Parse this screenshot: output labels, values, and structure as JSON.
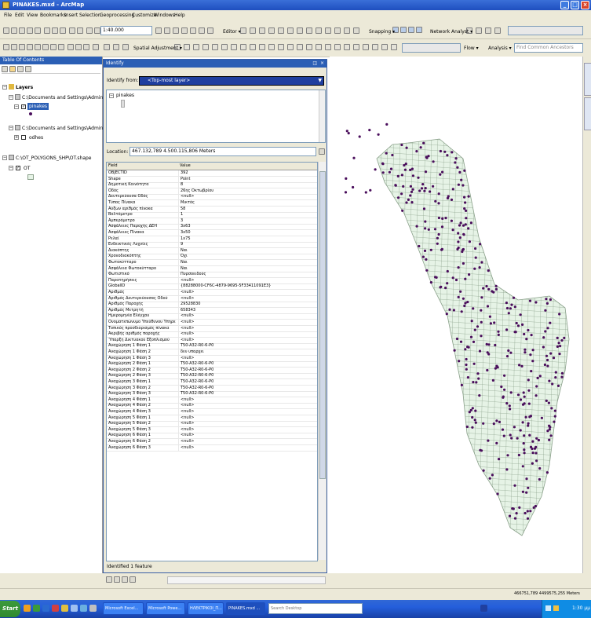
{
  "window": {
    "title": "PINAKES.mxd - ArcMap"
  },
  "menu": [
    "File",
    "Edit",
    "View",
    "Bookmarks",
    "Insert",
    "Selection",
    "Geoprocessing",
    "Customize",
    "Windows",
    "Help"
  ],
  "toolbar": {
    "scale": "1:40.000",
    "editor": "Editor ▾",
    "snapping": "Snapping ▾",
    "network_analyst": "Network Analyst ▾",
    "spatial_adjustment": "Spatial Adjustment ▾",
    "flow": "Flow ▾",
    "analysis": "Analysis ▾",
    "find_common_ancestors": "Find Common Ancestors"
  },
  "toc": {
    "title": "Table Of Contents",
    "layers_label": "Layers",
    "group1_path": "C:\\Documents and Settings\\Administrator\\Desk",
    "layer_pinakes": "pinakes",
    "group2_path": "C:\\Documents and Settings\\Administrator\\Desk",
    "layer_odhes": "odhes",
    "group3_path": "C:\\OT_POLYGONS_SHP\\OT.shape",
    "layer_ot": "OT"
  },
  "identify": {
    "title": "Identify",
    "identify_from_label": "Identify from:",
    "identify_from_value": "<Top-most layer>",
    "tree_item": "pinakes",
    "location_label": "Location:",
    "location_value": "467.132,789  4.500.115,806 Meters",
    "col_field": "Field",
    "col_value": "Value",
    "footer": "Identified 1 feature",
    "rows": [
      {
        "f": "OBJECTID",
        "v": "392"
      },
      {
        "f": "Shape",
        "v": "Point"
      },
      {
        "f": "Δημοτική Κοινότητα",
        "v": "8"
      },
      {
        "f": "Οδός",
        "v": "26ης Οκτωβρίου"
      },
      {
        "f": "Δευτερεύουσα Οδός",
        "v": "<null>"
      },
      {
        "f": "Τύπος Πίνακα",
        "v": "Μικτός"
      },
      {
        "f": "Αύξων αριθμός πίνακα",
        "v": "58"
      },
      {
        "f": "Βολτόμετρο",
        "v": "1"
      },
      {
        "f": "Αμπερόμετρο",
        "v": "3"
      },
      {
        "f": "Ασφάλειες Παροχής ΔΕΗ",
        "v": "3x63"
      },
      {
        "f": "Ασφάλειες Πίνακα",
        "v": "3x50"
      },
      {
        "f": "Ρελαί",
        "v": "1x75"
      },
      {
        "f": "Ενδεικτικές Λυχνίες",
        "v": "9"
      },
      {
        "f": "Διακόπτης",
        "v": "Ναι"
      },
      {
        "f": "Χρονοδιακόπτης",
        "v": "Όχι"
      },
      {
        "f": "Φωτοκύτταρο",
        "v": "Ναι"
      },
      {
        "f": "Ασφάλεια Φωτοκύτταρο",
        "v": "Ναι"
      },
      {
        "f": "Φωτιστικό",
        "v": "Πυρσοειδούς"
      },
      {
        "f": "Παρατηρήσεις",
        "v": "<null>"
      },
      {
        "f": "GlobalID",
        "v": "{88288000-CF6C-4879-9695-5F33411091E3}"
      },
      {
        "f": "Αριθμός",
        "v": "<null>"
      },
      {
        "f": "Αριθμός Δευτερεύουσας Οδού",
        "v": "<null>"
      },
      {
        "f": "Αριθμός Παροχής",
        "v": "29528830"
      },
      {
        "f": "Αριθμός Μετρητή",
        "v": "658343"
      },
      {
        "f": "Ημερομηνία Ελέγχου",
        "v": "<null>"
      },
      {
        "f": "Ονοματεπώνυμο Υπεύθυνου Υπηρεσίας",
        "v": "<null>"
      },
      {
        "f": "Τοπικός προσδιορισμός πίνακα",
        "v": "<null>"
      },
      {
        "f": "Ακριβής αριθμός παροχής",
        "v": "<null>"
      },
      {
        "f": "Ύπαρξη Δικτυακού Εξοπλισμού",
        "v": "<null>"
      },
      {
        "f": "Αναχώρηση 1 Φάση 1",
        "v": "T50-A32-R0-6-P0"
      },
      {
        "f": "Αναχώρηση 1 Φάση 2",
        "v": "δεν υπαρχει"
      },
      {
        "f": "Αναχώρηση 1 Φάση 3",
        "v": "<null>"
      },
      {
        "f": "Αναχώρηση 2 Φάση 1",
        "v": "T50-A32-R0-6-P0"
      },
      {
        "f": "Αναχώρηση 2 Φάση 2",
        "v": "T50-A32-R0-6-P0"
      },
      {
        "f": "Αναχώρηση 2 Φάση 3",
        "v": "T50-A32-R0-6-P0"
      },
      {
        "f": "Αναχώρηση 3 Φάση 1",
        "v": "T50-A32-R0-6-P0"
      },
      {
        "f": "Αναχώρηση 3 Φάση 2",
        "v": "T50-A32-R0-6-P0"
      },
      {
        "f": "Αναχώρηση 3 Φάση 3",
        "v": "T50-A32-R0-6-P0"
      },
      {
        "f": "Αναχώρηση 4 Φάση 1",
        "v": "<null>"
      },
      {
        "f": "Αναχώρηση 4 Φάση 2",
        "v": "<null>"
      },
      {
        "f": "Αναχώρηση 4 Φάση 3",
        "v": "<null>"
      },
      {
        "f": "Αναχώρηση 5 Φάση 1",
        "v": "<null>"
      },
      {
        "f": "Αναχώρηση 5 Φάση 2",
        "v": "<null>"
      },
      {
        "f": "Αναχώρηση 5 Φάση 3",
        "v": "<null>"
      },
      {
        "f": "Αναχώρηση 6 Φάση 1",
        "v": "<null>"
      },
      {
        "f": "Αναχώρηση 6 Φάση 2",
        "v": "<null>"
      },
      {
        "f": "Αναχώρηση 6 Φάση 3",
        "v": "<null>"
      }
    ]
  },
  "status": {
    "coords": "466751,789  4499575,255 Meters"
  },
  "taskbar": {
    "start": "Start",
    "tasks": [
      "Microsoft Excel...",
      "Microsoft Powe...",
      "ΗΛΕΚΤΡΙΚΟΙ_Π...",
      "PINAKES.mxd ..."
    ],
    "search_placeholder": "Search Desktop",
    "clock": "1:30 μμ"
  },
  "colors": {
    "point": "#4a0e5c",
    "polygon_fill": "#e6f3e6",
    "polygon_stroke": "#8aa08a",
    "title_blue": "#2b5fb5"
  }
}
